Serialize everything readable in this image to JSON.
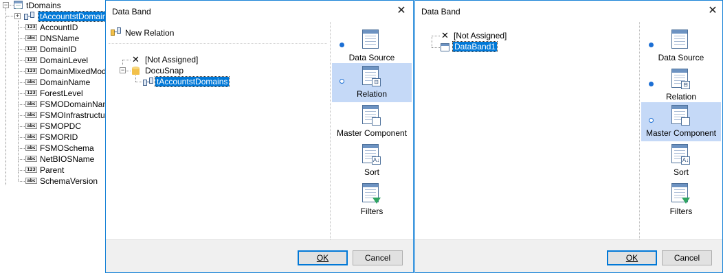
{
  "field_tree": {
    "root": "tDomains",
    "selected_relation": "tAccountstDomains",
    "fields": [
      {
        "type": "123",
        "name": "AccountID"
      },
      {
        "type": "abc",
        "name": "DNSName"
      },
      {
        "type": "123",
        "name": "DomainID"
      },
      {
        "type": "123",
        "name": "DomainLevel"
      },
      {
        "type": "123",
        "name": "DomainMixedMode"
      },
      {
        "type": "abc",
        "name": "DomainName"
      },
      {
        "type": "123",
        "name": "ForestLevel"
      },
      {
        "type": "abc",
        "name": "FSMODomainNamin"
      },
      {
        "type": "abc",
        "name": "FSMOInfrastructure"
      },
      {
        "type": "abc",
        "name": "FSMOPDC"
      },
      {
        "type": "abc",
        "name": "FSMORID"
      },
      {
        "type": "abc",
        "name": "FSMOSchema"
      },
      {
        "type": "abc",
        "name": "NetBIOSName"
      },
      {
        "type": "123",
        "name": "Parent"
      },
      {
        "type": "abc",
        "name": "SchemaVersion"
      }
    ]
  },
  "dialog1": {
    "title": "Data Band",
    "toolbar_new_relation": "New Relation",
    "tree": {
      "not_assigned": "[Not Assigned]",
      "datasource": "DocuSnap",
      "relation": "tAccountstDomains"
    },
    "ok": "OK",
    "cancel": "Cancel"
  },
  "dialog2": {
    "title": "Data Band",
    "tree": {
      "not_assigned": "[Not Assigned]",
      "band": "DataBand1"
    },
    "ok": "OK",
    "cancel": "Cancel"
  },
  "nav": {
    "data_source": "Data Source",
    "relation": "Relation",
    "master_component": "Master Component",
    "sort": "Sort",
    "filters": "Filters"
  },
  "colors": {
    "accent": "#0078d7",
    "active_nav": "#c5d9f7",
    "dialog_border": "#1883d7",
    "footer": "#f0f0f0"
  }
}
